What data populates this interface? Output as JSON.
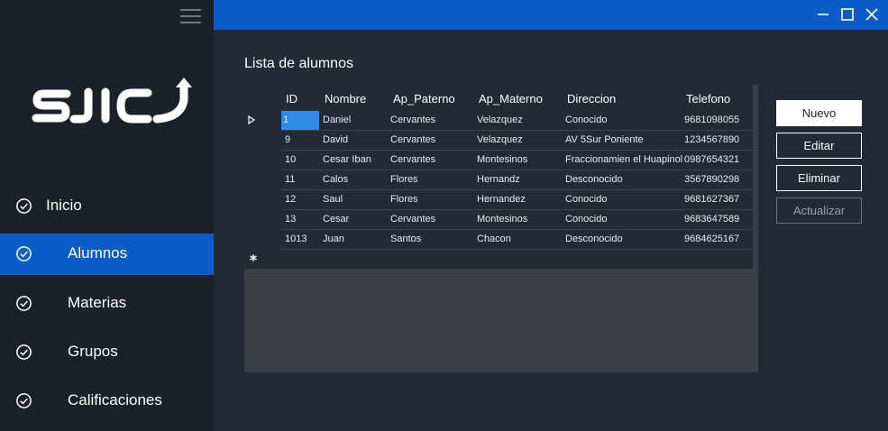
{
  "sidebar": {
    "logo_text": "SJIC",
    "items": [
      {
        "label": "Inicio",
        "icon": "check-circle-icon",
        "active": false
      },
      {
        "label": "Alumnos",
        "icon": "check-circle-icon",
        "active": true
      },
      {
        "label": "Materias",
        "icon": "check-circle-icon",
        "active": false
      },
      {
        "label": "Grupos",
        "icon": "check-circle-icon",
        "active": false
      },
      {
        "label": "Calificaciones",
        "icon": "check-circle-icon",
        "active": false
      }
    ]
  },
  "main": {
    "title": "Lista de alumnos",
    "table": {
      "columns": [
        "ID",
        "Nombre",
        "Ap_Paterno",
        "Ap_Materno",
        "Direccion",
        "Telefono"
      ],
      "rows": [
        [
          "1",
          "Daniel",
          "Cervantes",
          "Velazquez",
          "Conocido",
          "9681098055"
        ],
        [
          "9",
          "David",
          "Cervantes",
          "Velazquez",
          "AV 5Sur Poniente",
          "1234567890"
        ],
        [
          "10",
          "Cesar Iban",
          "Cervantes",
          "Montesinos",
          "Fraccionamien el Huapinol",
          "0987654321"
        ],
        [
          "11",
          "Calos",
          "Flores",
          "Hernandz",
          "Desconocido",
          "3567890298"
        ],
        [
          "12",
          "Saul",
          "Flores",
          "Hernandez",
          "Conocido",
          "9681627367"
        ],
        [
          "13",
          "Cesar",
          "Cervantes",
          "Montesinos",
          "Conocido",
          "9683647589"
        ],
        [
          "1013",
          "Juan",
          "Santos",
          "Chacon",
          "Desconocido",
          "9684625167"
        ]
      ]
    }
  },
  "actions": {
    "new_label": "Nuevo",
    "edit_label": "Editar",
    "delete_label": "Eliminar",
    "refresh_label": "Actualizar"
  },
  "colors": {
    "accent": "#0b5cc7",
    "sidebar_bg": "#1b2129",
    "content_bg": "#232a35",
    "selection": "#2e8ae6"
  }
}
